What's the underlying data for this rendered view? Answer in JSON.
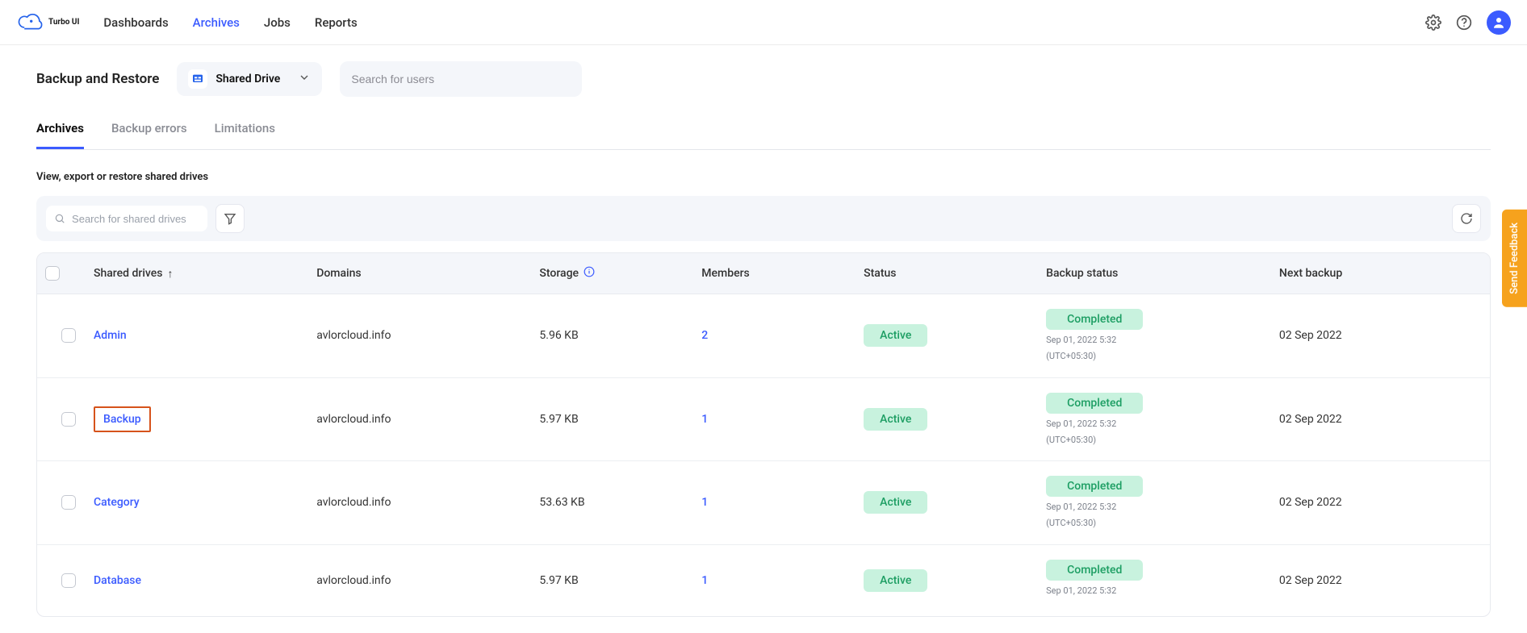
{
  "brand": "Turbo UI",
  "nav": {
    "items": [
      {
        "label": "Dashboards",
        "active": false
      },
      {
        "label": "Archives",
        "active": true
      },
      {
        "label": "Jobs",
        "active": false
      },
      {
        "label": "Reports",
        "active": false
      }
    ]
  },
  "page": {
    "title": "Backup and Restore",
    "dropdown_label": "Shared Drive",
    "search_placeholder": "Search for users"
  },
  "tabs": [
    {
      "label": "Archives",
      "active": true
    },
    {
      "label": "Backup errors",
      "active": false
    },
    {
      "label": "Limitations",
      "active": false
    }
  ],
  "subtitle": "View, export or restore shared drives",
  "search_drives_placeholder": "Search for shared drives",
  "columns": {
    "drives": "Shared drives",
    "domains": "Domains",
    "storage": "Storage",
    "members": "Members",
    "status": "Status",
    "backup_status": "Backup status",
    "next_backup": "Next backup"
  },
  "rows": [
    {
      "name": "Admin",
      "highlight": false,
      "domain": "avlorcloud.info",
      "storage": "5.96 KB",
      "members": "2",
      "status": "Active",
      "backup": "Completed",
      "backup_time_line1": "Sep 01, 2022 5:32",
      "backup_time_line2": "(UTC+05:30)",
      "next": "02 Sep 2022"
    },
    {
      "name": "Backup",
      "highlight": true,
      "domain": "avlorcloud.info",
      "storage": "5.97 KB",
      "members": "1",
      "status": "Active",
      "backup": "Completed",
      "backup_time_line1": "Sep 01, 2022 5:32",
      "backup_time_line2": "(UTC+05:30)",
      "next": "02 Sep 2022"
    },
    {
      "name": "Category",
      "highlight": false,
      "domain": "avlorcloud.info",
      "storage": "53.63 KB",
      "members": "1",
      "status": "Active",
      "backup": "Completed",
      "backup_time_line1": "Sep 01, 2022 5:32",
      "backup_time_line2": "(UTC+05:30)",
      "next": "02 Sep 2022"
    },
    {
      "name": "Database",
      "highlight": false,
      "domain": "avlorcloud.info",
      "storage": "5.97 KB",
      "members": "1",
      "status": "Active",
      "backup": "Completed",
      "backup_time_line1": "Sep 01, 2022 5:32",
      "backup_time_line2": "",
      "next": "02 Sep 2022"
    }
  ],
  "feedback_label": "Send Feedback"
}
